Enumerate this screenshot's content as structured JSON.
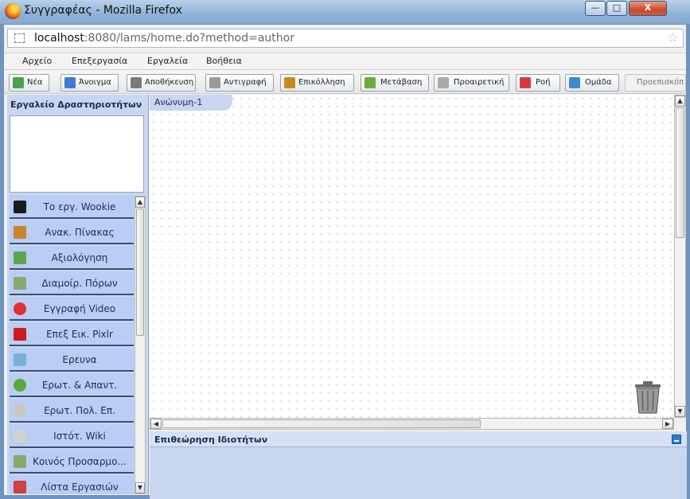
{
  "window": {
    "title": "Συγγραφέας - Mozilla Firefox",
    "minimize": "—",
    "maximize": "□",
    "close": "X"
  },
  "urlbar": {
    "host": "localhost",
    "rest": ":8080/lams/home.do?method=author",
    "star": "☆"
  },
  "menu": {
    "items": [
      "Αρχείο",
      "Επεξεργασία",
      "Εργαλεία",
      "Βοήθεια"
    ]
  },
  "toolbar": {
    "buttons": [
      {
        "label": "Νέα",
        "icon": "new-icon",
        "color": "#4aa34a"
      },
      {
        "label": "Άνοιγμα",
        "icon": "folder-icon",
        "color": "#3c7bd0"
      },
      {
        "label": "Αποθήκευση",
        "icon": "save-icon",
        "color": "#7a7a7a"
      },
      {
        "label": "Αντιγραφή",
        "icon": "copy-icon",
        "color": "#9a9a9a"
      },
      {
        "label": "Επικόλληση",
        "icon": "paste-icon",
        "color": "#c98a1d"
      },
      {
        "label": "Μετάβαση",
        "icon": "pencil-icon",
        "color": "#6eaa3c"
      },
      {
        "label": "Προαιρετική",
        "icon": "optional-icon",
        "color": "#aaa"
      },
      {
        "label": "Ροή",
        "icon": "flow-icon",
        "color": "#d43b3b"
      },
      {
        "label": "Ομάδα",
        "icon": "group-icon",
        "color": "#3b8ad4"
      },
      {
        "label": "Προεπισκόπ",
        "icon": "",
        "color": ""
      }
    ]
  },
  "left_panel": {
    "title": "Εργαλείο Δραστηριοτήτων",
    "tools": [
      {
        "label": "Το εργ. Wookie",
        "icon": "wookie-icon",
        "color": "#1a1a1a"
      },
      {
        "label": "Ανακ. Πίνακας",
        "icon": "noticeboard-icon",
        "color": "#c8862a"
      },
      {
        "label": "Αξιολόγηση",
        "icon": "assessment-icon",
        "color": "#5aa64a"
      },
      {
        "label": "Διαμοίρ. Πόρων",
        "icon": "resources-icon",
        "color": "#8aa86a"
      },
      {
        "label": "Εγγραφή Video",
        "icon": "video-record-icon",
        "color": "#e03030"
      },
      {
        "label": "Επεξ Εικ. Pixlr",
        "icon": "pixlr-icon",
        "color": "#cc1b1b"
      },
      {
        "label": "Ερευνα",
        "icon": "survey-icon",
        "color": "#7ab0d8"
      },
      {
        "label": "Ερωτ. & Απαντ.",
        "icon": "qa-icon",
        "color": "#5aaa3a"
      },
      {
        "label": "Ερωτ. Πολ. Επ.",
        "icon": "mcq-icon",
        "color": "#c8c8c8"
      },
      {
        "label": "Ιστότ. Wiki",
        "icon": "wiki-icon",
        "color": "#d0d0d0"
      },
      {
        "label": "Κοινός Προσαρμο...",
        "icon": "sharedforum-icon",
        "color": "#8aa86a"
      },
      {
        "label": "Λίστα Εργασιών",
        "icon": "tasklist-icon",
        "color": "#d04040"
      }
    ]
  },
  "canvas": {
    "tab_label": "Ανώνυμη-1"
  },
  "properties": {
    "title": "Επιθεώρηση Ιδιοτήτων"
  }
}
